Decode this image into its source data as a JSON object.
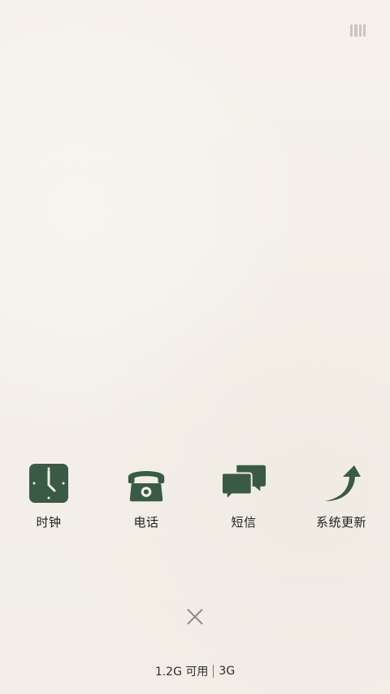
{
  "apps": [
    {
      "label": "时钟",
      "icon": "clock-icon"
    },
    {
      "label": "电话",
      "icon": "phone-icon"
    },
    {
      "label": "短信",
      "icon": "message-icon"
    },
    {
      "label": "系统更新",
      "icon": "update-arrow-icon"
    }
  ],
  "memory": {
    "available": "1.2G 可用",
    "total": "3G"
  },
  "colors": {
    "icon_green": "#3b5a45",
    "background": "#f3efe8",
    "text": "#1f1f1f"
  }
}
